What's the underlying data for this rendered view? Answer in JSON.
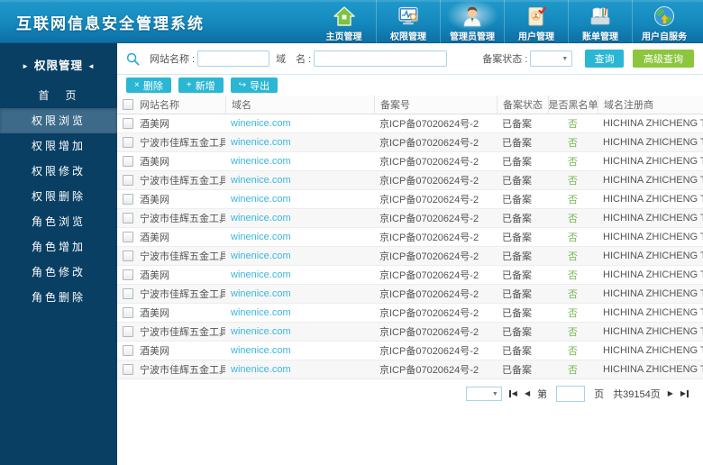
{
  "app": {
    "title": "互联网信息安全管理系统"
  },
  "topnav": {
    "items": [
      {
        "id": "home",
        "label": "主页管理",
        "icon": "home-icon",
        "active": false
      },
      {
        "id": "permission",
        "label": "权限管理",
        "icon": "monitor-icon",
        "active": false
      },
      {
        "id": "admin",
        "label": "管理员管理",
        "icon": "admin-person-icon",
        "active": true
      },
      {
        "id": "user",
        "label": "用户管理",
        "icon": "user-doc-icon",
        "active": false
      },
      {
        "id": "billing",
        "label": "账单管理",
        "icon": "ledger-icon",
        "active": false
      },
      {
        "id": "self-service",
        "label": "用户自服务",
        "icon": "globe-icon",
        "active": false
      }
    ]
  },
  "sidebar": {
    "arrow_left": "►",
    "header": "权限管理",
    "arrow_right": "◄",
    "items": [
      {
        "id": "home",
        "label": "首　页",
        "active": false
      },
      {
        "id": "perm-browse",
        "label": "权限浏览",
        "active": true
      },
      {
        "id": "perm-add",
        "label": "权限增加",
        "active": false
      },
      {
        "id": "perm-modify",
        "label": "权限修改",
        "active": false
      },
      {
        "id": "perm-delete",
        "label": "权限删除",
        "active": false
      },
      {
        "id": "role-browse",
        "label": "角色浏览",
        "active": false
      },
      {
        "id": "role-add",
        "label": "角色增加",
        "active": false
      },
      {
        "id": "role-modify",
        "label": "角色修改",
        "active": false
      },
      {
        "id": "role-delete",
        "label": "角色删除",
        "active": false
      }
    ]
  },
  "search": {
    "site_label": "网站名称 :",
    "site_value": "",
    "domain_label": "域　名 :",
    "domain_value": "",
    "status_label": "备案状态 :",
    "status_value": "",
    "caret": "▼",
    "query_btn": "查询",
    "adv_btn": "高级查询"
  },
  "actions": [
    {
      "name": "delete-button",
      "icon_name": "delete-x-icon",
      "icon": "×",
      "label": "删除"
    },
    {
      "name": "add-button",
      "icon_name": "plus-icon",
      "icon": "+",
      "label": "新增"
    },
    {
      "name": "export-button",
      "icon_name": "export-arrow-icon",
      "icon": "↪",
      "label": "导出"
    }
  ],
  "table": {
    "headers": [
      "网站名称",
      "域名",
      "备案号",
      "备案状态",
      "是否黑名单",
      "域名注册商"
    ],
    "rows": [
      {
        "site": "酒美网",
        "domain": "winenice.com",
        "record_no": "京ICP备07020624号-2",
        "status": "已备案",
        "blacklist": "否",
        "registrar": "HICHINA ZHICHENG TECHNOLOGY"
      },
      {
        "site": "宁波市佳辉五金工具厂",
        "domain": "winenice.com",
        "record_no": "京ICP备07020624号-2",
        "status": "已备案",
        "blacklist": "否",
        "registrar": "HICHINA ZHICHENG TECHNOLOGY"
      },
      {
        "site": "酒美网",
        "domain": "winenice.com",
        "record_no": "京ICP备07020624号-2",
        "status": "已备案",
        "blacklist": "否",
        "registrar": "HICHINA ZHICHENG TECHNOLOGY"
      },
      {
        "site": "宁波市佳辉五金工具厂",
        "domain": "winenice.com",
        "record_no": "京ICP备07020624号-2",
        "status": "已备案",
        "blacklist": "否",
        "registrar": "HICHINA ZHICHENG TECHNOLOGY"
      },
      {
        "site": "酒美网",
        "domain": "winenice.com",
        "record_no": "京ICP备07020624号-2",
        "status": "已备案",
        "blacklist": "否",
        "registrar": "HICHINA ZHICHENG TECHNOLOGY"
      },
      {
        "site": "宁波市佳辉五金工具厂",
        "domain": "winenice.com",
        "record_no": "京ICP备07020624号-2",
        "status": "已备案",
        "blacklist": "否",
        "registrar": "HICHINA ZHICHENG TECHNOLOGY"
      },
      {
        "site": "酒美网",
        "domain": "winenice.com",
        "record_no": "京ICP备07020624号-2",
        "status": "已备案",
        "blacklist": "否",
        "registrar": "HICHINA ZHICHENG TECHNOLOGY"
      },
      {
        "site": "宁波市佳辉五金工具厂",
        "domain": "winenice.com",
        "record_no": "京ICP备07020624号-2",
        "status": "已备案",
        "blacklist": "否",
        "registrar": "HICHINA ZHICHENG TECHNOLOGY"
      },
      {
        "site": "酒美网",
        "domain": "winenice.com",
        "record_no": "京ICP备07020624号-2",
        "status": "已备案",
        "blacklist": "否",
        "registrar": "HICHINA ZHICHENG TECHNOLOGY"
      },
      {
        "site": "宁波市佳辉五金工具厂",
        "domain": "winenice.com",
        "record_no": "京ICP备07020624号-2",
        "status": "已备案",
        "blacklist": "否",
        "registrar": "HICHINA ZHICHENG TECHNOLOGY"
      },
      {
        "site": "酒美网",
        "domain": "winenice.com",
        "record_no": "京ICP备07020624号-2",
        "status": "已备案",
        "blacklist": "否",
        "registrar": "HICHINA ZHICHENG TECHNOLOGY"
      },
      {
        "site": "宁波市佳辉五金工具厂",
        "domain": "winenice.com",
        "record_no": "京ICP备07020624号-2",
        "status": "已备案",
        "blacklist": "否",
        "registrar": "HICHINA ZHICHENG TECHNOLOGY"
      },
      {
        "site": "酒美网",
        "domain": "winenice.com",
        "record_no": "京ICP备07020624号-2",
        "status": "已备案",
        "blacklist": "否",
        "registrar": "HICHINA ZHICHENG TECHNOLOGY"
      },
      {
        "site": "宁波市佳辉五金工具厂",
        "domain": "winenice.com",
        "record_no": "京ICP备07020624号-2",
        "status": "已备案",
        "blacklist": "否",
        "registrar": "HICHINA ZHICHENG TECHNOLOGY"
      }
    ]
  },
  "pagination": {
    "page_size_value": "",
    "first_icon": "◀",
    "prev_icon": "◀",
    "page_prefix": "第",
    "page_value": "",
    "page_suffix": "页",
    "total": "共39154页",
    "next_icon": "▶",
    "last_icon": "▶",
    "caret": "▼"
  },
  "colors": {
    "header_blue_top": "#2099cb",
    "header_blue_bottom": "#0d6da4",
    "sidebar_navy": "#093f63",
    "sidebar_active": "#3c6a88",
    "accent_cyan": "#2bb7d4",
    "accent_green": "#8cc63e",
    "link_cyan": "#3ab6de",
    "ok_green": "#76b852"
  }
}
